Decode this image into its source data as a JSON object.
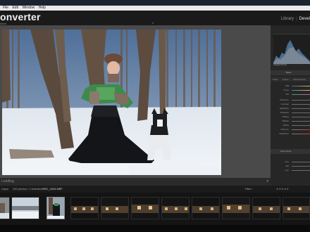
{
  "menu": {
    "items": [
      "File",
      "Edit",
      "Window",
      "Help"
    ]
  },
  "header": {
    "title": "onverter",
    "subtitle": "Ideal",
    "modules": [
      "Library",
      "Devel"
    ]
  },
  "develop_panel": {
    "original_label": "Original Photo",
    "sections": [
      "Basic",
      "Tone Curve"
    ],
    "tabs": [
      "Treat",
      "Colour",
      "Monochrome"
    ],
    "sliders": [
      "WB",
      "Temp",
      "Tint",
      "Exposure",
      "Contrast",
      "Highlights",
      "Shadows",
      "Whites",
      "Blacks",
      "Clarity",
      "Vibrance",
      "Saturation"
    ],
    "bottom": [
      "Hue",
      "Sat",
      "Lum"
    ],
    "previous_label": "Previous"
  },
  "toolbar": {
    "label": "Loading",
    "caret": "▾"
  },
  "filmstrip_bar": {
    "source": "ruspo",
    "count": "100 photos / 1 selected /",
    "filename": "DSC_2424.NEF",
    "filter_label": "Filter :",
    "stars": "★★★★★"
  },
  "colors": {
    "accent": "#5e8fbf",
    "sky": "#4f6f99",
    "background": "#0f0f0f"
  },
  "icons": [
    "collapse-caret-icon",
    "histogram-icon",
    "star-rating-icon"
  ]
}
